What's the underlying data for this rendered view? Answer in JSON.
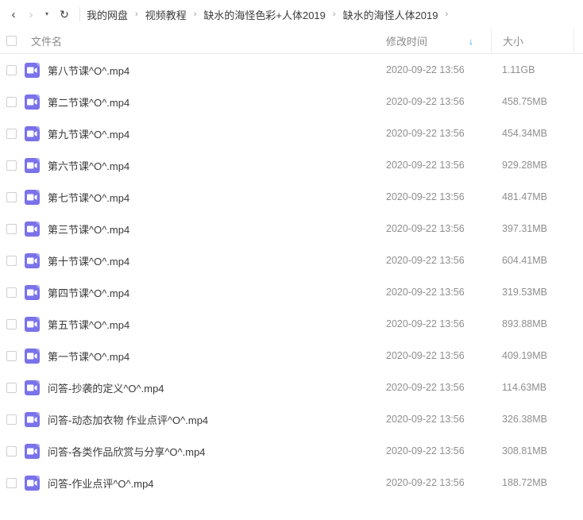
{
  "toolbar": {
    "back_icon": "chevron-left-icon",
    "forward_icon": "chevron-right-icon",
    "dropdown_icon": "caret-down-icon",
    "refresh_icon": "refresh-icon",
    "back_glyph": "‹",
    "forward_glyph": "›",
    "caret_glyph": "▾",
    "refresh_glyph": "↻"
  },
  "breadcrumb": {
    "separator": "›",
    "items": [
      {
        "label": "我的网盘"
      },
      {
        "label": "视频教程"
      },
      {
        "label": "缺水的海怪色彩+人体2019"
      },
      {
        "label": "缺水的海怪人体2019"
      }
    ]
  },
  "table": {
    "columns": {
      "name": "文件名",
      "modified": "修改时间",
      "size": "大小"
    },
    "sort": {
      "column": "修改时间",
      "direction": "desc",
      "arrow_glyph": "↓",
      "arrow_color": "#1aa3f0"
    },
    "select_all_checked": false,
    "file_icon": "video-file-icon",
    "icon_color": "#7a72ea",
    "rows": [
      {
        "name": "第八节课^O^.mp4",
        "modified": "2020-09-22 13:56",
        "size": "1.11GB"
      },
      {
        "name": "第二节课^O^.mp4",
        "modified": "2020-09-22 13:56",
        "size": "458.75MB"
      },
      {
        "name": "第九节课^O^.mp4",
        "modified": "2020-09-22 13:56",
        "size": "454.34MB"
      },
      {
        "name": "第六节课^O^.mp4",
        "modified": "2020-09-22 13:56",
        "size": "929.28MB"
      },
      {
        "name": "第七节课^O^.mp4",
        "modified": "2020-09-22 13:56",
        "size": "481.47MB"
      },
      {
        "name": "第三节课^O^.mp4",
        "modified": "2020-09-22 13:56",
        "size": "397.31MB"
      },
      {
        "name": "第十节课^O^.mp4",
        "modified": "2020-09-22 13:56",
        "size": "604.41MB"
      },
      {
        "name": "第四节课^O^.mp4",
        "modified": "2020-09-22 13:56",
        "size": "319.53MB"
      },
      {
        "name": "第五节课^O^.mp4",
        "modified": "2020-09-22 13:56",
        "size": "893.88MB"
      },
      {
        "name": "第一节课^O^.mp4",
        "modified": "2020-09-22 13:56",
        "size": "409.19MB"
      },
      {
        "name": "问答-抄袭的定义^O^.mp4",
        "modified": "2020-09-22 13:56",
        "size": "114.63MB"
      },
      {
        "name": "问答-动态加衣物 作业点评^O^.mp4",
        "modified": "2020-09-22 13:56",
        "size": "326.38MB"
      },
      {
        "name": "问答-各类作品欣赏与分享^O^.mp4",
        "modified": "2020-09-22 13:56",
        "size": "308.81MB"
      },
      {
        "name": "问答-作业点评^O^.mp4",
        "modified": "2020-09-22 13:56",
        "size": "188.72MB"
      }
    ]
  }
}
